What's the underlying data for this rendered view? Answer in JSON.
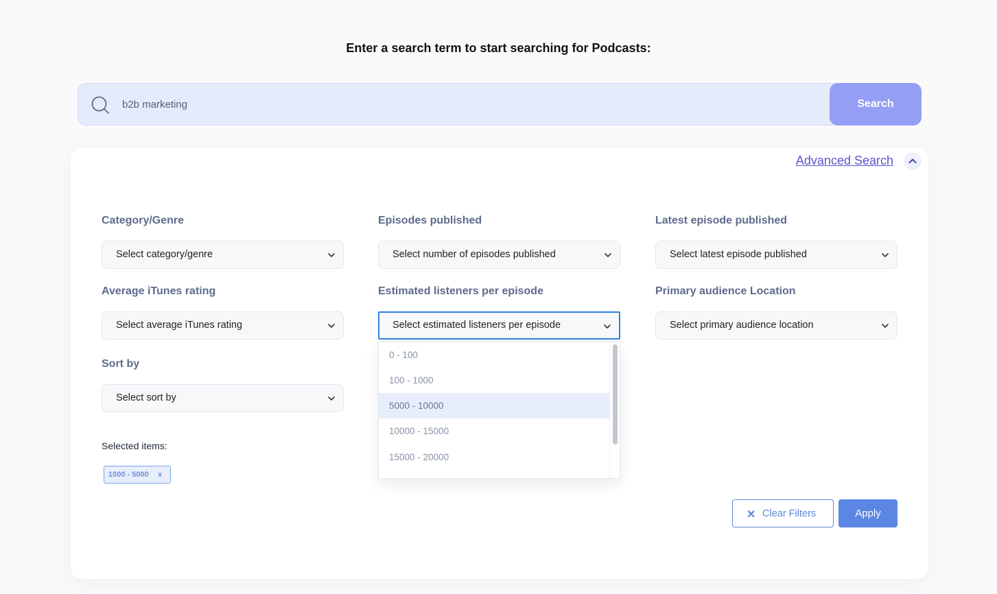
{
  "heading": "Enter a search term to start searching for Podcasts:",
  "search": {
    "value": "b2b marketing",
    "button_label": "Search"
  },
  "advanced": {
    "link_label": "Advanced Search",
    "expanded": true
  },
  "filters": {
    "category": {
      "label": "Category/Genre",
      "placeholder": "Select category/genre"
    },
    "episodes": {
      "label": "Episodes published",
      "placeholder": "Select number of episodes published"
    },
    "latest": {
      "label": "Latest episode published",
      "placeholder": "Select latest episode published"
    },
    "rating": {
      "label": "Average iTunes rating",
      "placeholder": "Select average iTunes rating"
    },
    "listeners": {
      "label": "Estimated listeners per episode",
      "placeholder": "Select estimated listeners per episode",
      "options": [
        "0 - 100",
        "100 - 1000",
        "5000 - 10000",
        "10000 - 15000",
        "15000 - 20000"
      ],
      "highlighted": "5000 - 10000"
    },
    "location": {
      "label": "Primary audience Location",
      "placeholder": "Select primary audience location"
    },
    "sort": {
      "label": "Sort by",
      "placeholder": "Select sort by"
    }
  },
  "selected": {
    "label": "Selected items:",
    "items": [
      {
        "text": "1000 - 5000",
        "remove": "x"
      }
    ]
  },
  "actions": {
    "clear_icon": "✕",
    "clear_label": "Clear Filters",
    "apply_label": "Apply"
  },
  "colors": {
    "accent": "#5b86e3",
    "search_button": "#949ef5",
    "link": "#5a55c9"
  }
}
